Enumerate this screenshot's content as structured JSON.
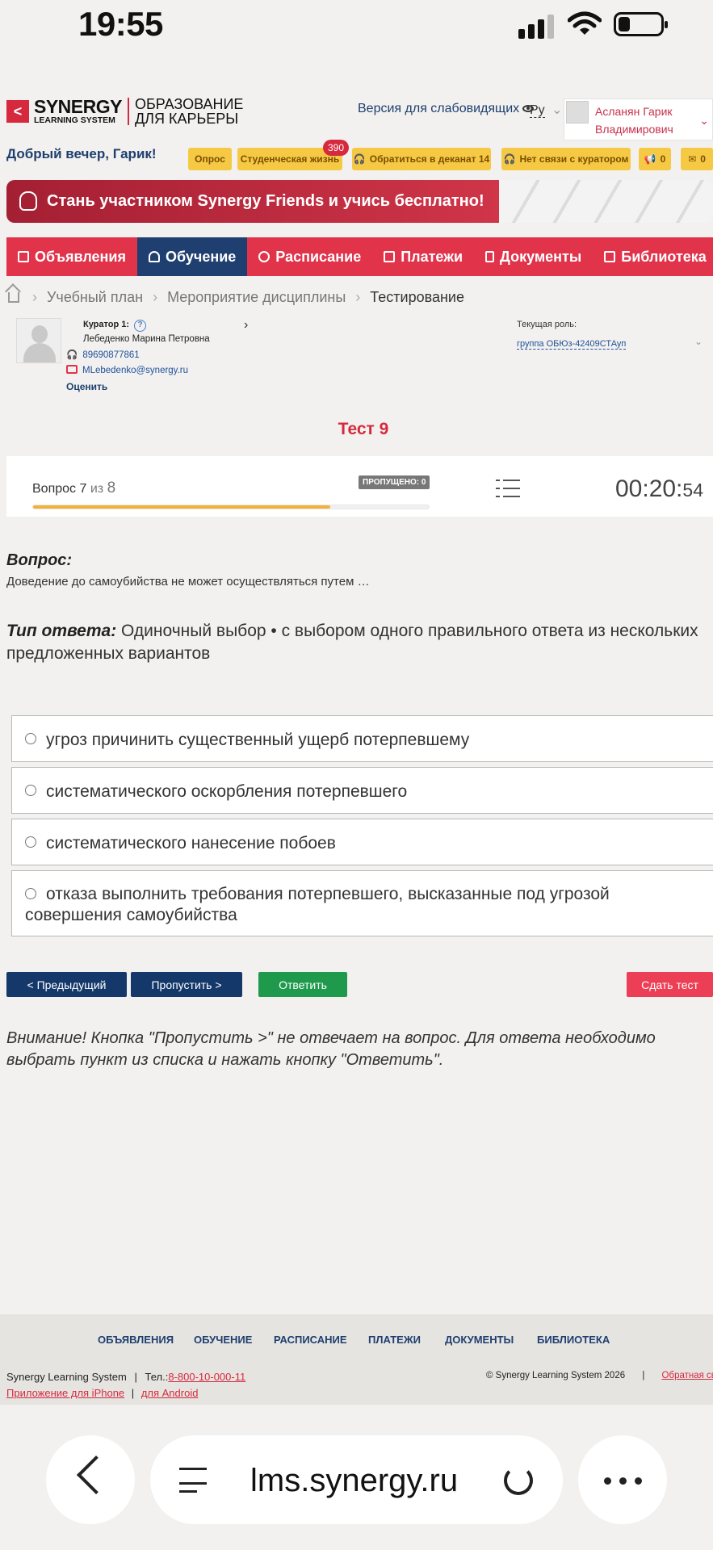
{
  "status_bar": {
    "time": "19:55"
  },
  "header": {
    "logo_main": "SYNERGY",
    "logo_sub": "LEARNING SYSTEM",
    "slogan_line1": "ОБРАЗОВАНИЕ",
    "slogan_line2": "ДЛЯ КАРЬЕРЫ",
    "low_vision": "Версия для слабовидящих",
    "language": "Ру",
    "user_name_line1": "Асланян Гарик",
    "user_name_line2": "Владимирович"
  },
  "greeting": "Добрый вечер, Гарик!",
  "quick_buttons": {
    "survey": "Опрос",
    "student_life": "Студенческая жизнь",
    "student_life_badge": "390",
    "dean": "Обратиться в деканат 14",
    "no_contact": "Нет связи с куратором",
    "announce_count": "0",
    "mail_count": "0"
  },
  "banner": {
    "text": "Стань участником Synergy Friends и учись бесплатно!"
  },
  "nav": [
    {
      "label": "Объявления"
    },
    {
      "label": "Обучение"
    },
    {
      "label": "Расписание"
    },
    {
      "label": "Платежи"
    },
    {
      "label": "Документы"
    },
    {
      "label": "Библиотека"
    }
  ],
  "breadcrumbs": {
    "b1": "Учебный план",
    "b2": "Мероприятие дисциплины",
    "current": "Тестирование"
  },
  "curator": {
    "title": "Куратор 1:",
    "name": "Лебеденко Марина Петровна",
    "phone": "89690877861",
    "email": "MLebedenko@synergy.ru",
    "rate": "Оценить"
  },
  "role": {
    "label": "Текущая роль:",
    "value": "группа ОБЮз-42409СТАуп"
  },
  "test": {
    "title": "Тест 9",
    "question_prefix": "Вопрос",
    "question_num": "7",
    "of_word": "из",
    "question_total": "8",
    "skipped": "ПРОПУЩЕНО: 0",
    "progress": 0.75,
    "timer_main": "00:20:",
    "timer_sec": "54"
  },
  "question": {
    "heading": "Вопрос:",
    "text": "Доведение до самоубийства не может осуществляться путем …",
    "type_label": "Тип ответа:",
    "type_text": "Одиночный выбор • с выбором одного правильного ответа из нескольких предложенных вариантов"
  },
  "options": [
    "угроз причинить существенный ущерб потерпевшему",
    "систематического оскорбления потерпевшего",
    "систематического нанесение побоев",
    "отказа выполнить требования потерпевшего, высказанные под угрозой совершения самоубийства"
  ],
  "buttons": {
    "prev": "< Предыдущий",
    "skip": "Пропустить >",
    "answer": "Ответить",
    "finish": "Сдать тест"
  },
  "warning": "Внимание! Кнопка \"Пропустить >\" не отвечает на вопрос. Для ответа необходимо выбрать пункт из списка и нажать кнопку \"Ответить\".",
  "footer": {
    "nav": [
      "ОБЪЯВЛЕНИЯ",
      "ОБУЧЕНИЕ",
      "РАСПИСАНИЕ",
      "ПЛАТЕЖИ",
      "ДОКУМЕНТЫ",
      "БИБЛИОТЕКА"
    ],
    "company": "Synergy Learning System",
    "phone_label": "Тел.:",
    "phone": "8-800-10-000-11",
    "iphone": "Приложение для iPhone",
    "android": "для Android",
    "copyright": "© Synergy Learning System 2026",
    "feedback": "Обратная связь"
  },
  "browser": {
    "host": "lms.synergy.ru"
  },
  "colors": {
    "accent_red": "#e1344a",
    "navy": "#1e3f6f",
    "yellow": "#f6c945",
    "green": "#1f9a4c"
  }
}
